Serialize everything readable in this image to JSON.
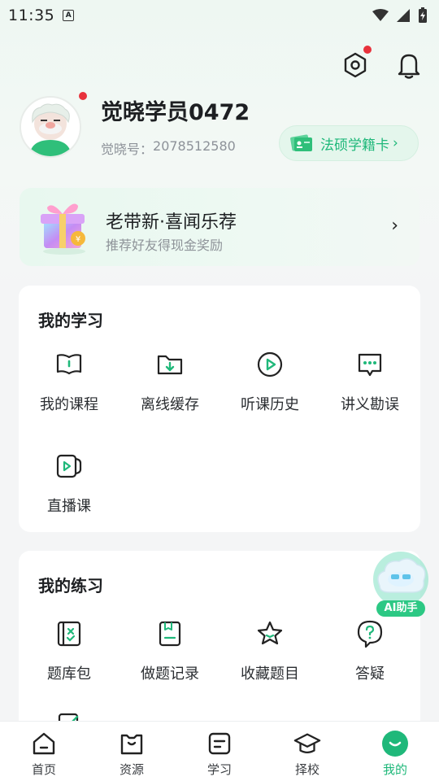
{
  "status_bar": {
    "time": "11:35",
    "notification_icon": "A"
  },
  "header": {
    "username": "觉晓学员0472",
    "user_id_label": "觉晓号：",
    "user_id_value": "2078512580",
    "card_badge_label": "法硕学籍卡",
    "settings_icon": "settings-hexagon-icon",
    "bell_icon": "bell-icon"
  },
  "promo": {
    "title": "老带新·喜闻乐荐",
    "subtitle": "推荐好友得现金奖励",
    "arrow": "›"
  },
  "study_section": {
    "title": "我的学习",
    "items": [
      {
        "label": "我的课程",
        "icon": "book-icon"
      },
      {
        "label": "离线缓存",
        "icon": "download-folder-icon"
      },
      {
        "label": "听课历史",
        "icon": "play-circle-icon"
      },
      {
        "label": "讲义勘误",
        "icon": "chat-dots-icon"
      },
      {
        "label": "直播课",
        "icon": "live-video-icon"
      }
    ]
  },
  "practice_section": {
    "title": "我的练习",
    "items": [
      {
        "label": "题库包",
        "icon": "question-bank-icon"
      },
      {
        "label": "做题记录",
        "icon": "record-icon"
      },
      {
        "label": "收藏题目",
        "icon": "star-icon"
      },
      {
        "label": "答疑",
        "icon": "question-bubble-icon"
      }
    ]
  },
  "ai_assistant": {
    "label": "AI助手"
  },
  "tabbar": {
    "items": [
      {
        "label": "首页",
        "icon": "home-icon",
        "active": false
      },
      {
        "label": "资源",
        "icon": "resource-icon",
        "active": false
      },
      {
        "label": "学习",
        "icon": "study-icon",
        "active": false
      },
      {
        "label": "择校",
        "icon": "graduation-cap-icon",
        "active": false
      },
      {
        "label": "我的",
        "icon": "profile-icon",
        "active": true
      }
    ]
  },
  "colors": {
    "accent": "#1fb87a",
    "badge_red": "#e8323c",
    "background": "#f4f5f6"
  }
}
